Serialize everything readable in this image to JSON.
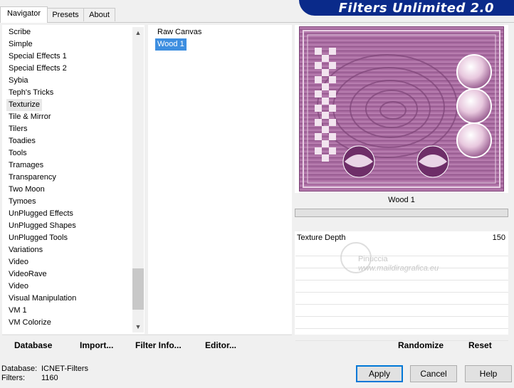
{
  "tabs": [
    {
      "label": "Navigator"
    },
    {
      "label": "Presets"
    },
    {
      "label": "About"
    }
  ],
  "banner": {
    "title": "Filters Unlimited 2.0"
  },
  "categories": [
    "Scribe",
    "Simple",
    "Special Effects 1",
    "Special Effects 2",
    "Sybia",
    "Teph's Tricks",
    "Texturize",
    "Tile & Mirror",
    "Tilers",
    "Toadies",
    "Tools",
    "Tramages",
    "Transparency",
    "Two Moon",
    "Tymoes",
    "UnPlugged Effects",
    "UnPlugged Shapes",
    "UnPlugged Tools",
    "Variations",
    "Video",
    "VideoRave",
    "Video",
    "Visual Manipulation",
    "VM 1",
    "VM Colorize"
  ],
  "selected_category": "Texturize",
  "filters": [
    "Raw Canvas",
    "Wood 1"
  ],
  "selected_filter": "Wood 1",
  "preview": {
    "filter_name": "Wood 1"
  },
  "params": [
    {
      "label": "Texture Depth",
      "value": "150"
    }
  ],
  "watermark": {
    "line1": "Pinuccia",
    "line2": "www.maildiragrafica.eu"
  },
  "toolbar": {
    "database": "Database",
    "import": "Import...",
    "filter_info": "Filter Info...",
    "editor": "Editor...",
    "randomize": "Randomize",
    "reset": "Reset"
  },
  "status": {
    "database_label": "Database:",
    "database_value": "ICNET-Filters",
    "filters_label": "Filters:",
    "filters_value": "1160"
  },
  "buttons": {
    "apply": "Apply",
    "cancel": "Cancel",
    "help": "Help"
  },
  "colors": {
    "accent": "#0a2a8a",
    "selection": "#3d8ee0",
    "preview_base": "#a86aa0"
  }
}
